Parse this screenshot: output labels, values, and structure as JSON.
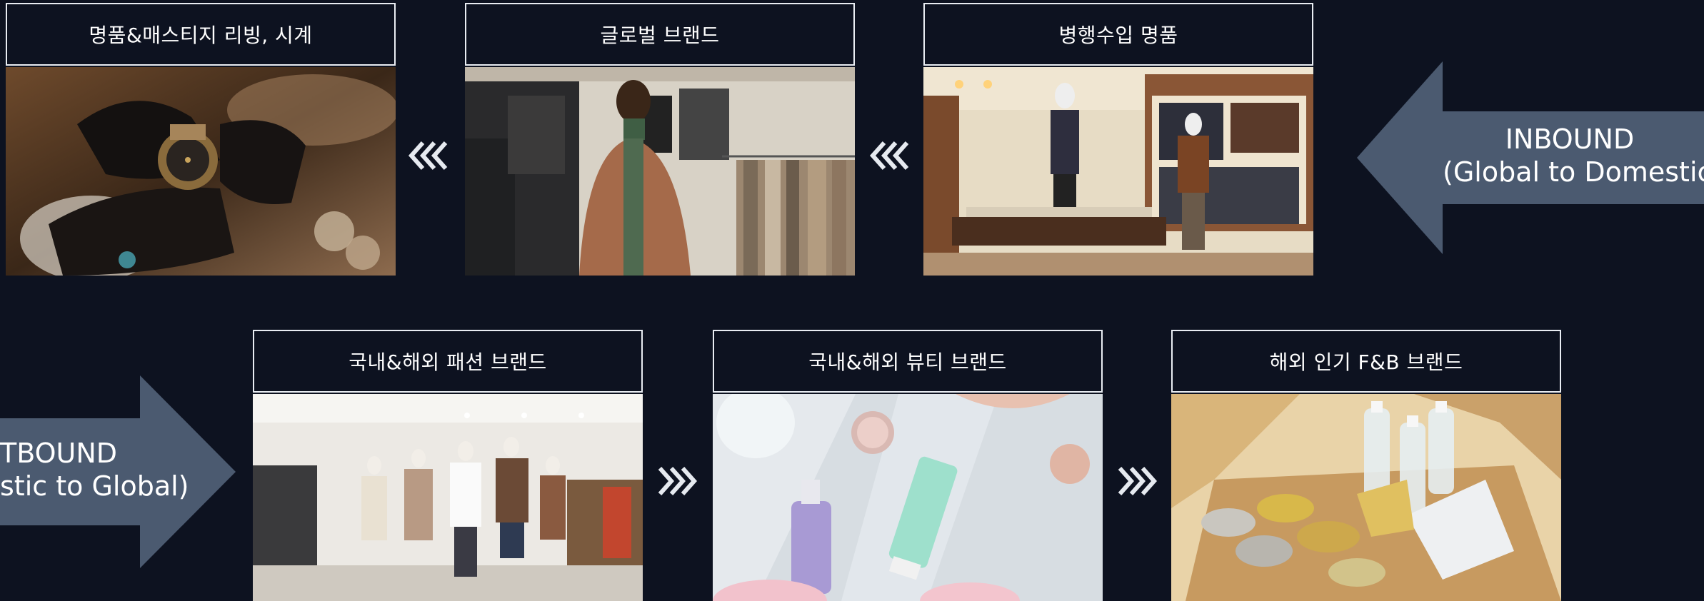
{
  "inbound": {
    "label_line1": "INBOUND",
    "label_line2": "(Global to Domestic)",
    "arrow_color": "#4b5a70",
    "cards": [
      {
        "title": "명품&매스티지 리빙, 시계",
        "photo": "luxury-watch-photo"
      },
      {
        "title": "글로벌 브랜드",
        "photo": "global-brand-menswear-photo"
      },
      {
        "title": "병행수입 명품",
        "photo": "parallel-import-boutique-photo"
      }
    ]
  },
  "outbound": {
    "label_line1": "TBOUND",
    "label_line2": "stic to Global)",
    "arrow_color": "#4b5a70",
    "cards": [
      {
        "title": "국내&해외 패션 브랜드",
        "photo": "fashion-store-mannequins-photo"
      },
      {
        "title": "국내&해외 뷰티 브랜드",
        "photo": "beauty-products-flatlay-photo"
      },
      {
        "title": "해외 인기 F&B 브랜드",
        "photo": "fnb-goods-box-photo"
      }
    ]
  },
  "colors": {
    "background": "#0d1220",
    "title_border": "#e9edf3",
    "chevron": "#e6eaf0"
  }
}
